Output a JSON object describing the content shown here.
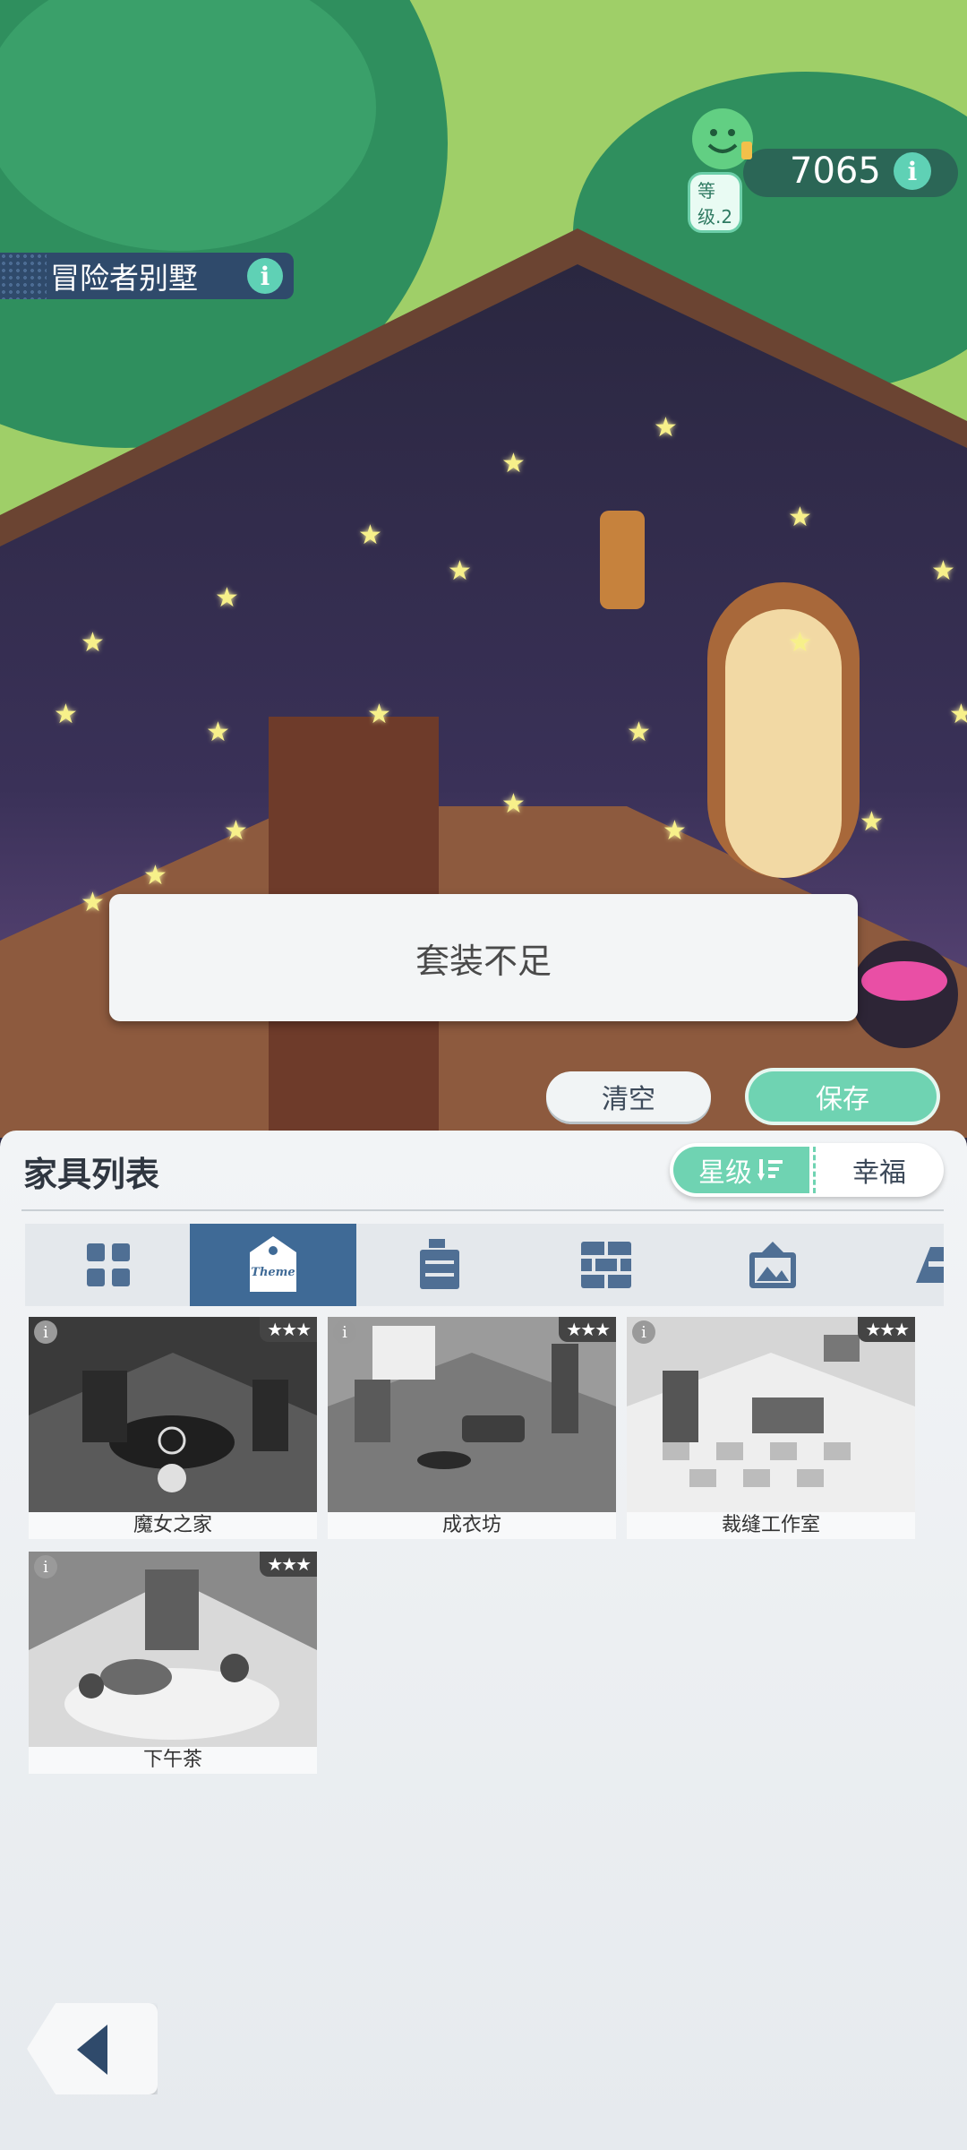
{
  "hud": {
    "house_name": "冒险者别墅",
    "info_glyph": "i",
    "level_label": "等级.2",
    "score": "7065"
  },
  "toast": {
    "message": "套装不足"
  },
  "actions": {
    "clear_label": "清空",
    "save_label": "保存"
  },
  "panel": {
    "title": "家具列表",
    "sort": {
      "star_label": "星级",
      "happiness_label": "幸福"
    },
    "tabs": [
      {
        "icon": "grid-icon"
      },
      {
        "icon": "theme-tag-icon",
        "text": "Theme"
      },
      {
        "icon": "cabinet-icon"
      },
      {
        "icon": "wall-icon"
      },
      {
        "icon": "picture-icon"
      },
      {
        "icon": "floor-icon"
      }
    ],
    "items": [
      {
        "label": "魔女之家",
        "stars": "★★★"
      },
      {
        "label": "成衣坊",
        "stars": "★★★"
      },
      {
        "label": "裁缝工作室",
        "stars": "★★★"
      },
      {
        "label": "下午茶",
        "stars": "★★★"
      }
    ]
  },
  "colors": {
    "accent": "#6fd3b2",
    "navy": "#2f4a6b",
    "tab_active": "#3f6a96"
  }
}
